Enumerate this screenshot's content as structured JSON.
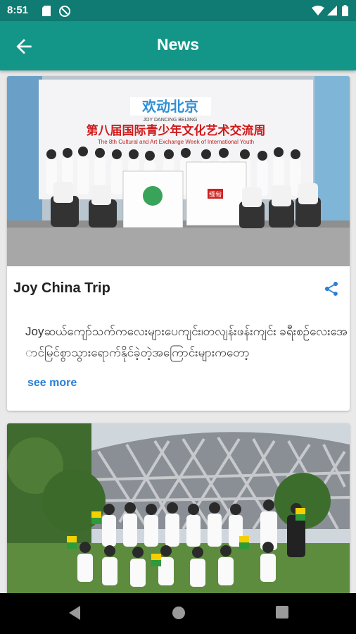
{
  "status": {
    "time": "8:51"
  },
  "appbar": {
    "title": "News"
  },
  "cards": [
    {
      "title": "Joy China Trip",
      "body": "Joyဆယ်ကျော်သက်ကလေးများပေကျင်း၊တလျန်းဖန်းကျင်း ခရီးစဉ်လေးအောင်မြင်စွာသွားရောက်နိုင်ခဲ့တဲ့အကြောင်းများကတော့",
      "see_more": "see more",
      "photo": {
        "banner_cn_slogan": "欢动北京",
        "banner_en_slogan": "JOY DANCING BEIJING",
        "banner_cn_title": "第八届国际青少年文化艺术交流周",
        "banner_en_title": "The 8th Cultural and Art Exchange Week of International Youth",
        "flag_text": "缅甸"
      }
    },
    {
      "title": "",
      "body": ""
    }
  ],
  "colors": {
    "primary": "#139688",
    "status": "#0f7b72",
    "link": "#2b7fd6"
  }
}
